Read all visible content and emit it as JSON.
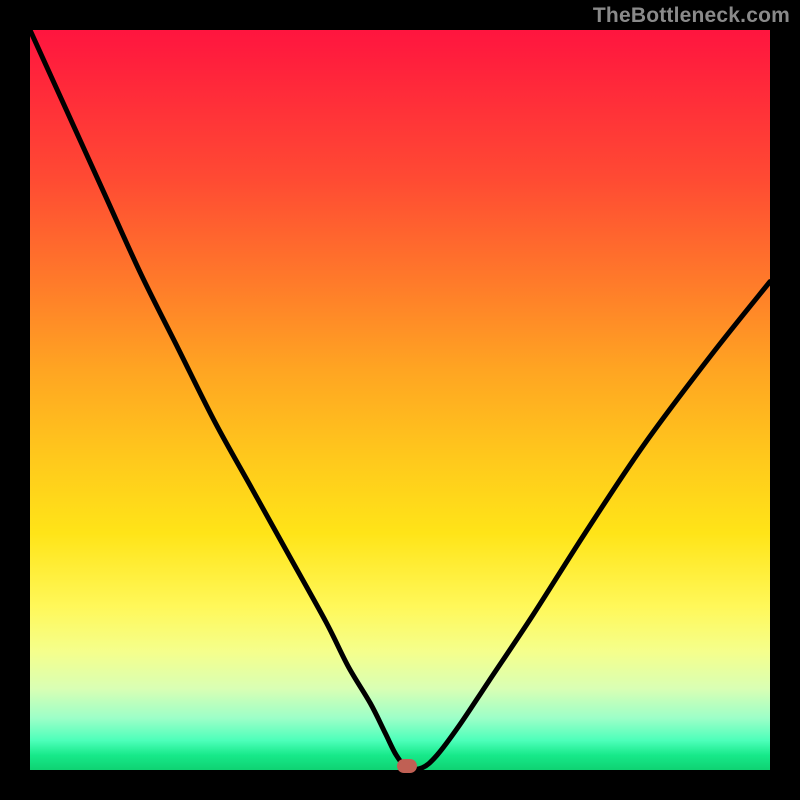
{
  "watermark": "TheBottleneck.com",
  "colors": {
    "curve": "#000000",
    "marker": "#c06054",
    "frame_bg": "#000000"
  },
  "chart_data": {
    "type": "line",
    "title": "",
    "xlabel": "",
    "ylabel": "",
    "xlim": [
      0,
      100
    ],
    "ylim": [
      0,
      100
    ],
    "series": [
      {
        "name": "bottleneck-curve",
        "x": [
          0,
          5,
          10,
          15,
          20,
          25,
          30,
          35,
          40,
          43,
          46,
          48,
          49.5,
          51,
          53,
          55,
          58,
          62,
          68,
          75,
          83,
          92,
          100
        ],
        "y": [
          100,
          89,
          78,
          67,
          57,
          47,
          38,
          29,
          20,
          14,
          9,
          5,
          2,
          0.3,
          0.3,
          2,
          6,
          12,
          21,
          32,
          44,
          56,
          66
        ]
      }
    ],
    "marker": {
      "x": 51,
      "y": 0.5
    },
    "gradient_stops": [
      {
        "pos": 0,
        "color": "#ff153f"
      },
      {
        "pos": 50,
        "color": "#ffc01c"
      },
      {
        "pos": 80,
        "color": "#fff85a"
      },
      {
        "pos": 100,
        "color": "#0fd272"
      }
    ]
  }
}
